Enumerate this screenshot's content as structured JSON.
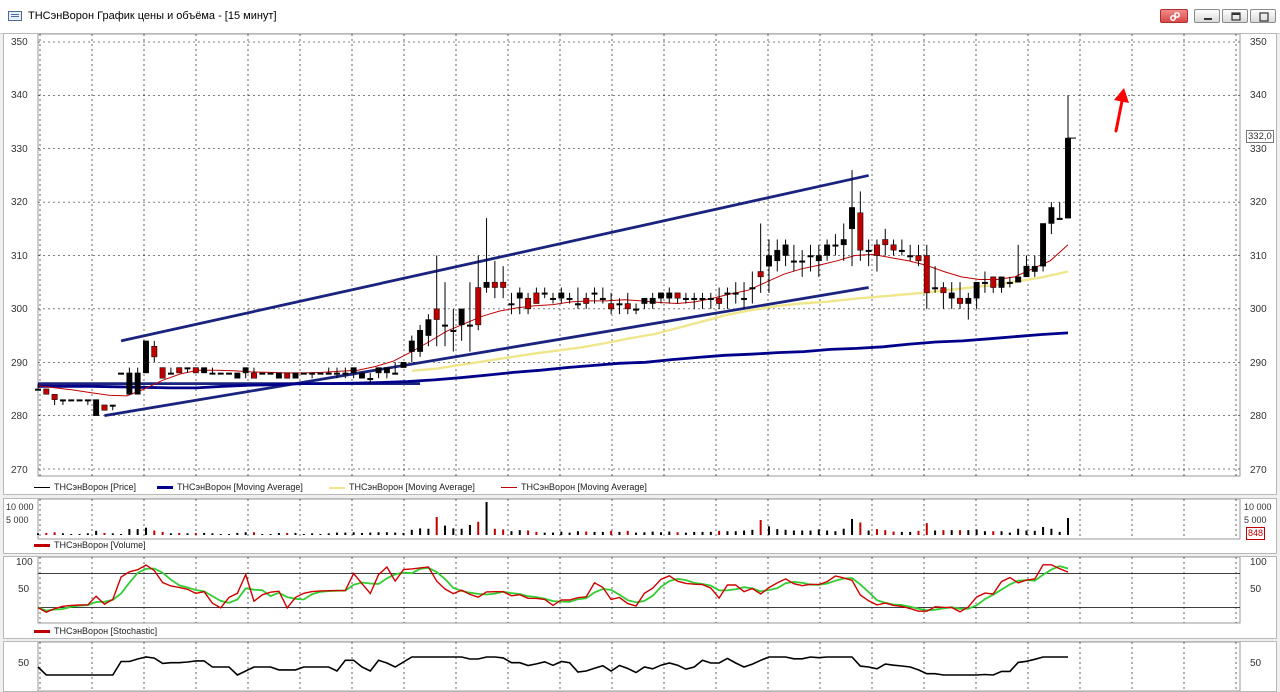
{
  "window": {
    "title": "ТНСэнВорон График цены и объёма - [15 минут]",
    "buttons": [
      "link-icon",
      "minimize-icon",
      "restore-icon",
      "close-icon"
    ]
  },
  "price_panel": {
    "y_ticks": [
      "350",
      "340",
      "330",
      "320",
      "310",
      "300",
      "290",
      "280",
      "270"
    ],
    "last_price": "332,0",
    "legend": [
      {
        "label": "ТНСэнВорон [Price]",
        "color": "#000000"
      },
      {
        "label": "ТНСэнВорон [Moving Average]",
        "color": "#00008b"
      },
      {
        "label": "ТНСэнВорон [Moving Average]",
        "color": "#f0e68c"
      },
      {
        "label": "ТНСэнВорон [Moving Average]",
        "color": "#c00000"
      }
    ]
  },
  "volume_panel": {
    "y_ticks_left": [
      "10 000",
      "5 000"
    ],
    "y_ticks_right": [
      "10 000",
      "5 000"
    ],
    "last_value": "848",
    "legend": {
      "label": "ТНСэнВорон [Volume]",
      "color": "#c00000"
    }
  },
  "stochastic_panel": {
    "y_ticks": [
      "100",
      "50"
    ],
    "legend": {
      "label": "ТНСэнВорон [Stochastic]",
      "color": "#c00000"
    }
  },
  "bottom_panel": {
    "y_ticks": [
      "50"
    ]
  },
  "chart_data": {
    "type": "candlestick",
    "ylim": [
      270,
      350
    ],
    "candles": [
      [
        285,
        286,
        285,
        285
      ],
      [
        285,
        285,
        284,
        284
      ],
      [
        284,
        284,
        282,
        283
      ],
      [
        283,
        283,
        282,
        283
      ],
      [
        283,
        283,
        283,
        283
      ],
      [
        283,
        283,
        283,
        283
      ],
      [
        283,
        283,
        282,
        283
      ],
      [
        280,
        283,
        280,
        283
      ],
      [
        282,
        282,
        281,
        281
      ],
      [
        282,
        282,
        281,
        282
      ],
      [
        288,
        288,
        288,
        288
      ],
      [
        284,
        289,
        284,
        288
      ],
      [
        284,
        289,
        284,
        288
      ],
      [
        288,
        294,
        288,
        294
      ],
      [
        293,
        294,
        290,
        291
      ],
      [
        289,
        289,
        287,
        287
      ],
      [
        288,
        289,
        288,
        288
      ],
      [
        289,
        289,
        288,
        288
      ],
      [
        289,
        289,
        288,
        289
      ],
      [
        289,
        289,
        288,
        288
      ],
      [
        288,
        289,
        288,
        289
      ],
      [
        288,
        289,
        288,
        288
      ],
      [
        288,
        288,
        288,
        288
      ],
      [
        288,
        288,
        288,
        288
      ],
      [
        287,
        288,
        287,
        288
      ],
      [
        288,
        289,
        287,
        289
      ],
      [
        288,
        289,
        287,
        287
      ],
      [
        288,
        288,
        288,
        288
      ],
      [
        288,
        288,
        288,
        288
      ],
      [
        287,
        288,
        287,
        288
      ],
      [
        288,
        288,
        287,
        287
      ],
      [
        287,
        288,
        287,
        288
      ],
      [
        288,
        288,
        288,
        288
      ],
      [
        288,
        288,
        287,
        288
      ],
      [
        288,
        288,
        288,
        288
      ],
      [
        288,
        289,
        288,
        288
      ],
      [
        288,
        289,
        287,
        288
      ],
      [
        288,
        289,
        287,
        288
      ],
      [
        288,
        289,
        287,
        289
      ],
      [
        287,
        288,
        287,
        288
      ],
      [
        287,
        288,
        286,
        287
      ],
      [
        288,
        289,
        287,
        289
      ],
      [
        288,
        289,
        287,
        289
      ],
      [
        288,
        290,
        288,
        288
      ],
      [
        289,
        290,
        289,
        290
      ],
      [
        292,
        295,
        290,
        294
      ],
      [
        292,
        297,
        291,
        296
      ],
      [
        295,
        299,
        293,
        298
      ],
      [
        300,
        310,
        293,
        298
      ],
      [
        297,
        305,
        293,
        297
      ],
      [
        296,
        300,
        292,
        296
      ],
      [
        297,
        300,
        294,
        300
      ],
      [
        297,
        305,
        292,
        297
      ],
      [
        304,
        310,
        296,
        297
      ],
      [
        304,
        317,
        303,
        305
      ],
      [
        305,
        309,
        302,
        304
      ],
      [
        305,
        308,
        302,
        304
      ],
      [
        301,
        303,
        299,
        301
      ],
      [
        302,
        304,
        299,
        303
      ],
      [
        302,
        303,
        299,
        300
      ],
      [
        303,
        304,
        302,
        301
      ],
      [
        303,
        304,
        302,
        303
      ],
      [
        302,
        303,
        301,
        302
      ],
      [
        302,
        304,
        301,
        303
      ],
      [
        302,
        303,
        301,
        302
      ],
      [
        301,
        304,
        300,
        301
      ],
      [
        302,
        303,
        300,
        301
      ],
      [
        303,
        304,
        301,
        303
      ],
      [
        302,
        304,
        301,
        302
      ],
      [
        301,
        303,
        299,
        300
      ],
      [
        301,
        302,
        299,
        301
      ],
      [
        301,
        303,
        299,
        300
      ],
      [
        300,
        301,
        299,
        300
      ],
      [
        301,
        302,
        300,
        302
      ],
      [
        301,
        303,
        300,
        302
      ],
      [
        302,
        303,
        301,
        303
      ],
      [
        302,
        304,
        301,
        303
      ],
      [
        303,
        303,
        301,
        302
      ],
      [
        302,
        303,
        301,
        302
      ],
      [
        302,
        303,
        300,
        302
      ],
      [
        302,
        303,
        300,
        302
      ],
      [
        302,
        303,
        300,
        302
      ],
      [
        302,
        304,
        300,
        301
      ],
      [
        303,
        304,
        300,
        303
      ],
      [
        303,
        305,
        301,
        303
      ],
      [
        302,
        305,
        300,
        302
      ],
      [
        304,
        307,
        301,
        304
      ],
      [
        307,
        316,
        303,
        306
      ],
      [
        308,
        313,
        303,
        310
      ],
      [
        309,
        313,
        307,
        311
      ],
      [
        310,
        313,
        308,
        312
      ],
      [
        309,
        312,
        307,
        309
      ],
      [
        309,
        311,
        306,
        309
      ],
      [
        310,
        312,
        307,
        310
      ],
      [
        309,
        312,
        306,
        310
      ],
      [
        310,
        313,
        309,
        312
      ],
      [
        312,
        314,
        310,
        312
      ],
      [
        312,
        316,
        309,
        313
      ],
      [
        315,
        326,
        308,
        319
      ],
      [
        318,
        322,
        309,
        311
      ],
      [
        311,
        313,
        308,
        311
      ],
      [
        312,
        313,
        307,
        310
      ],
      [
        313,
        315,
        310,
        312
      ],
      [
        312,
        313,
        310,
        311
      ],
      [
        311,
        313,
        310,
        311
      ],
      [
        310,
        312,
        309,
        310
      ],
      [
        310,
        312,
        308,
        309
      ],
      [
        310,
        312,
        300,
        303
      ],
      [
        304,
        308,
        303,
        304
      ],
      [
        304,
        305,
        300,
        303
      ],
      [
        302,
        305,
        300,
        303
      ],
      [
        302,
        305,
        300,
        301
      ],
      [
        301,
        303,
        298,
        302
      ],
      [
        302,
        305,
        300,
        305
      ],
      [
        305,
        307,
        303,
        305
      ],
      [
        306,
        306,
        303,
        304
      ],
      [
        304,
        306,
        303,
        306
      ],
      [
        305,
        306,
        304,
        305
      ],
      [
        305,
        312,
        305,
        306
      ],
      [
        306,
        310,
        306,
        308
      ],
      [
        307,
        310,
        306,
        308
      ],
      [
        308,
        313,
        307,
        316
      ],
      [
        316,
        320,
        314,
        319
      ],
      [
        317,
        320,
        317,
        317
      ],
      [
        317,
        340,
        317,
        332
      ]
    ],
    "moving_averages": [
      {
        "name": "ТНСэнВорон [Moving Average]",
        "color": "#00008b",
        "values": [
          285.5,
          285.5,
          285.5,
          285.4,
          285.3,
          285.2,
          285.2,
          285.5,
          285.7,
          285.8,
          286.0,
          286.0,
          286.1,
          286.2,
          286.4,
          286.7,
          287.1,
          287.6,
          288.1,
          288.5,
          289.0,
          289.4,
          289.8,
          290.0,
          290.5,
          290.9,
          291.3,
          291.5,
          291.8,
          292.0,
          292.4,
          292.6,
          292.9,
          293.4,
          293.8,
          294.0,
          294.4,
          294.8,
          295.2,
          295.5
        ]
      },
      {
        "name": "ТНСэнВорон [Moving Average]",
        "color": "#f0e68c",
        "values": [
          288.4,
          288.8,
          289.5,
          290.2,
          290.9,
          291.6,
          292.2,
          292.8,
          293.6,
          294.5,
          295.3,
          296.5,
          297.7,
          298.9,
          299.8,
          300.5,
          301.0,
          301.3,
          301.8,
          302.2,
          302.6,
          303.0,
          303.5,
          304.0,
          304.5,
          305.2,
          306.0,
          307.0
        ]
      },
      {
        "name": "ТНСэнВорон [Moving Average]",
        "color": "#c00000",
        "values": [
          285.6,
          285.2,
          284.8,
          284.3,
          283.8,
          283.7,
          285.0,
          286.6,
          287.8,
          288.5,
          288.5,
          288.4,
          288.2,
          288.1,
          288.0,
          288.0,
          288.1,
          288.3,
          288.5,
          289.2,
          290.2,
          291.9,
          293.8,
          295.8,
          297.2,
          298.6,
          299.6,
          300.2,
          300.6,
          300.8,
          301.3,
          301.5,
          301.5,
          301.7,
          301.5,
          301.2,
          301.0,
          301.3,
          302.0,
          302.8,
          303.5,
          305.0,
          306.5,
          307.5,
          308.2,
          309.0,
          310.0,
          310.2,
          309.6,
          309.0,
          308.2,
          307.0,
          306.0,
          305.5,
          305.5,
          306.0,
          307.5,
          309.0,
          312.0
        ]
      }
    ],
    "annotations": [
      "upper trend line",
      "lower trend line",
      "red arrow pointing up"
    ]
  }
}
